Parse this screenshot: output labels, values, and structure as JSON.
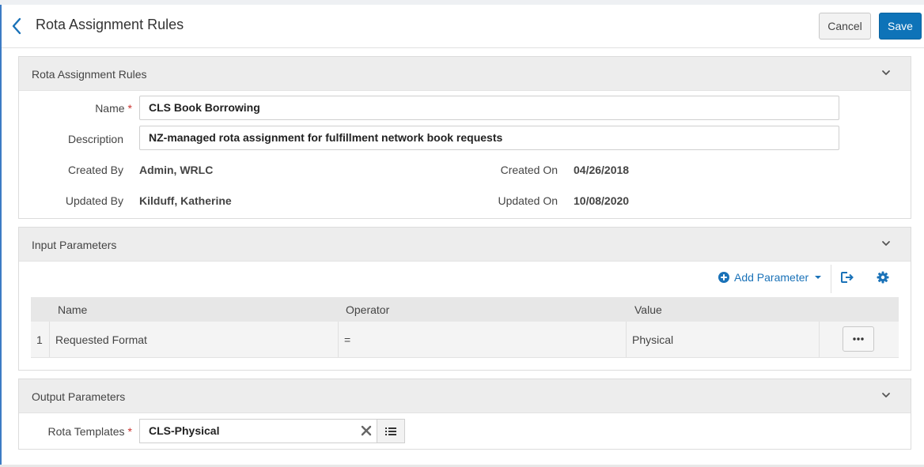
{
  "header": {
    "title": "Rota Assignment Rules",
    "cancel_label": "Cancel",
    "save_label": "Save"
  },
  "rules_section": {
    "title": "Rota Assignment Rules",
    "name_label": "Name",
    "name_value": "CLS Book Borrowing",
    "description_label": "Description",
    "description_value": "NZ-managed rota assignment for fulfillment network book requests",
    "created_by_label": "Created By",
    "created_by_value": "Admin, WRLC",
    "created_on_label": "Created On",
    "created_on_value": "04/26/2018",
    "updated_by_label": "Updated By",
    "updated_by_value": "Kilduff, Katherine",
    "updated_on_label": "Updated On",
    "updated_on_value": "10/08/2020"
  },
  "input_section": {
    "title": "Input Parameters",
    "add_parameter_label": "Add Parameter",
    "columns": [
      "Name",
      "Operator",
      "Value"
    ],
    "rows": [
      {
        "index": "1",
        "name": "Requested Format",
        "operator": "=",
        "value": "Physical"
      }
    ]
  },
  "output_section": {
    "title": "Output Parameters",
    "rota_templates_label": "Rota Templates",
    "rota_templates_value": "CLS-Physical"
  },
  "colors": {
    "accent": "#0e73b8",
    "required": "#c9302c",
    "link": "#1a72b8"
  },
  "icons": [
    "back-chevron-icon",
    "chevron-down-icon",
    "plus-circle-icon",
    "caret-down-icon",
    "export-icon",
    "gear-icon",
    "ellipsis-icon",
    "clear-x-icon",
    "list-icon"
  ]
}
